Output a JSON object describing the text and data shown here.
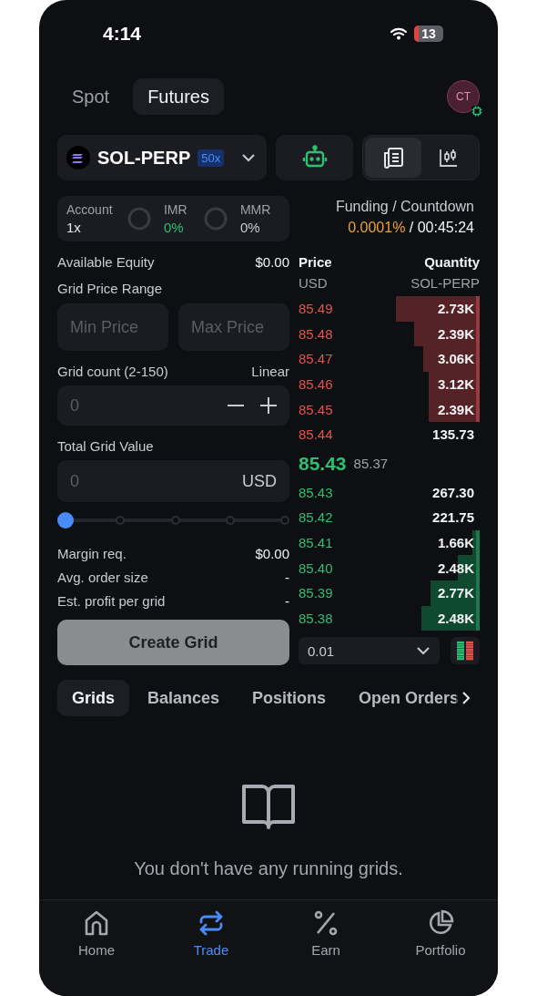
{
  "status_bar": {
    "time": "4:14",
    "battery": "13"
  },
  "header": {
    "tabs": [
      {
        "label": "Spot",
        "selected": false
      },
      {
        "label": "Futures",
        "selected": true
      }
    ],
    "avatar": "CT"
  },
  "market": {
    "symbol": "SOL-PERP",
    "leverage": "50x",
    "view_buttons": [
      {
        "kind": "book",
        "selected": true
      },
      {
        "kind": "chart",
        "selected": false
      }
    ]
  },
  "account": {
    "label": "Account",
    "value": "1x",
    "gauges": [
      {
        "label": "IMR",
        "value": "0%",
        "color": "#2fbf71"
      },
      {
        "label": "MMR",
        "value": "0%",
        "color": "#c9cbd0"
      }
    ]
  },
  "funding": {
    "label": "Funding / Countdown",
    "rate": "0.0001%",
    "separator": "/",
    "countdown": "00:45:24"
  },
  "grid_form": {
    "equity_label": "Available Equity",
    "equity_value": "$0.00",
    "range_label": "Grid Price Range",
    "min_placeholder": "Min Price",
    "max_placeholder": "Max Price",
    "count_label": "Grid count (2-150)",
    "mode": "Linear",
    "count_placeholder": "0",
    "value_label": "Total Grid Value",
    "value_placeholder": "0",
    "currency": "USD",
    "slider": {
      "level": 0
    },
    "summary": [
      {
        "label": "Margin req.",
        "value": "$0.00"
      },
      {
        "label": "Avg. order size",
        "value": "-"
      },
      {
        "label": "Est. profit per grid",
        "value": "-"
      }
    ],
    "submit": {
      "label": "Create Grid",
      "disabled": true
    }
  },
  "order_book": {
    "columns": [
      {
        "title": "Price",
        "unit": "USD"
      },
      {
        "title": "Quantity",
        "unit": "SOL-PERP"
      }
    ],
    "asks": [
      {
        "price": "85.49",
        "quantity": "2.73K"
      },
      {
        "price": "85.48",
        "quantity": "2.39K"
      },
      {
        "price": "85.47",
        "quantity": "3.06K"
      },
      {
        "price": "85.46",
        "quantity": "3.12K"
      },
      {
        "price": "85.45",
        "quantity": "2.39K"
      },
      {
        "price": "85.44",
        "quantity": "135.73"
      }
    ],
    "last_price": "85.43",
    "mark_price": "85.37",
    "bids": [
      {
        "price": "85.43",
        "quantity": "267.30"
      },
      {
        "price": "85.42",
        "quantity": "221.75"
      },
      {
        "price": "85.41",
        "quantity": "1.66K"
      },
      {
        "price": "85.40",
        "quantity": "2.48K"
      },
      {
        "price": "85.39",
        "quantity": "2.77K"
      },
      {
        "price": "85.38",
        "quantity": "2.48K"
      }
    ],
    "tick_size": "0.01"
  },
  "order_tabs": [
    {
      "label": "Grids",
      "selected": true
    },
    {
      "label": "Balances",
      "selected": false
    },
    {
      "label": "Positions",
      "selected": false
    },
    {
      "label": "Open Orders",
      "selected": false
    }
  ],
  "empty_message": "You don't have any running grids.",
  "nav": [
    {
      "label": "Home",
      "kind": "home",
      "selected": false
    },
    {
      "label": "Trade",
      "kind": "trade",
      "selected": true
    },
    {
      "label": "Earn",
      "kind": "earn",
      "selected": false
    },
    {
      "label": "Portfolio",
      "kind": "portfolio",
      "selected": false
    }
  ]
}
